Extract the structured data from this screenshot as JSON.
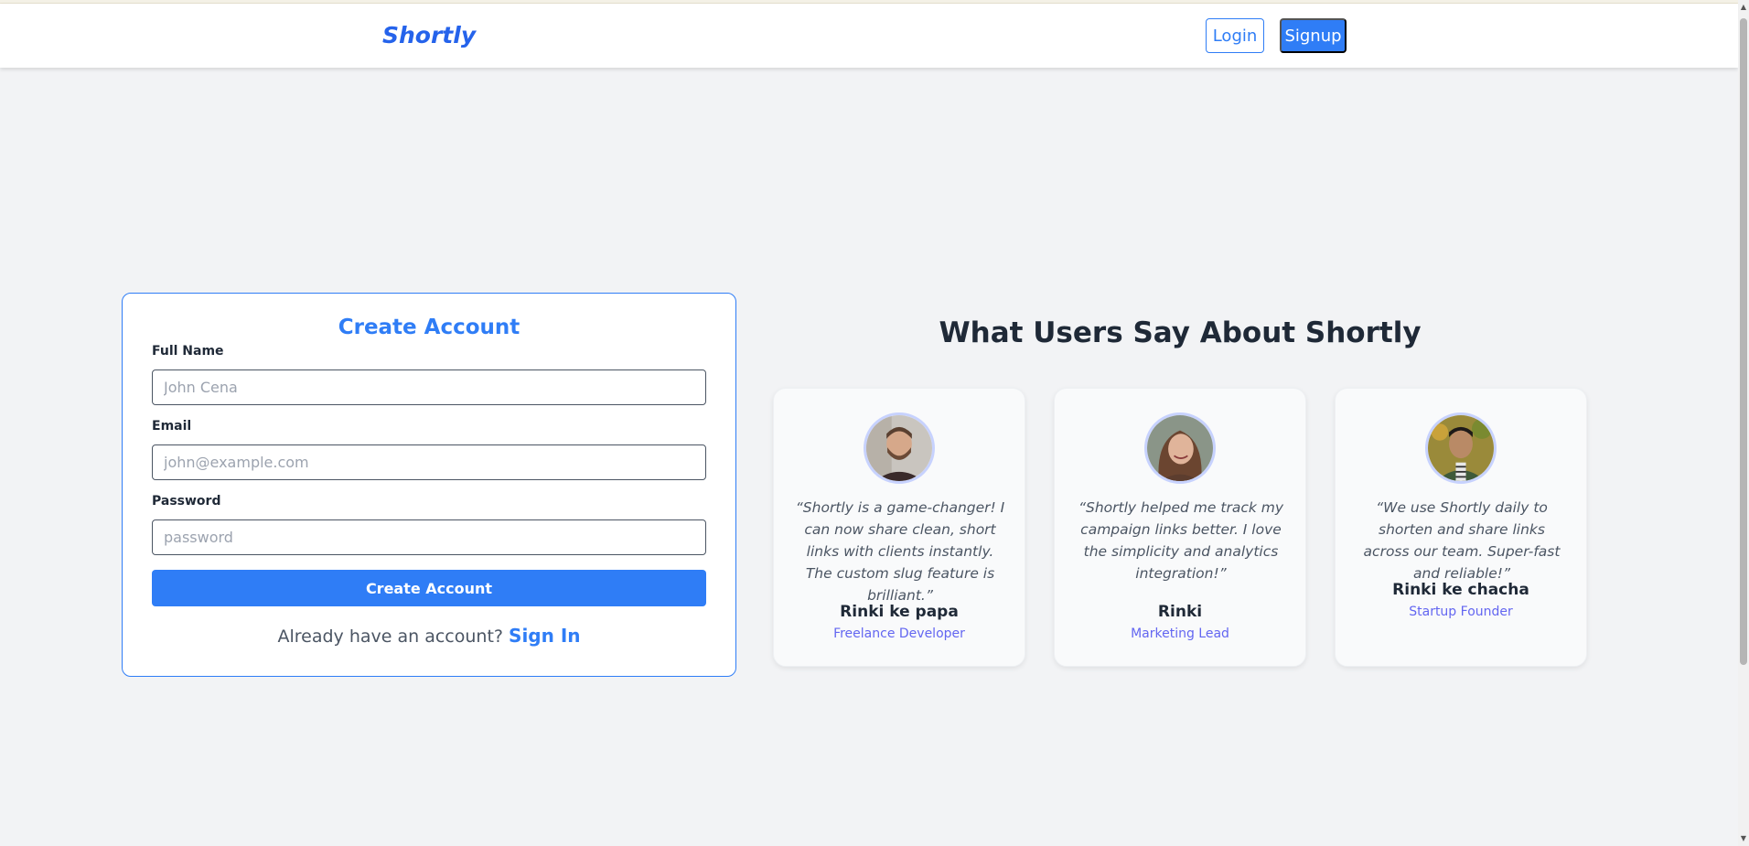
{
  "nav": {
    "brand": "Shortly",
    "login_label": "Login",
    "signup_label": "Signup"
  },
  "form": {
    "title": "Create Account",
    "fields": [
      {
        "label": "Full Name",
        "placeholder": "John Cena",
        "value": ""
      },
      {
        "label": "Email",
        "placeholder": "john@example.com",
        "value": ""
      },
      {
        "label": "Password",
        "placeholder": "password",
        "value": ""
      }
    ],
    "submit_label": "Create Account",
    "signin_prompt": "Already have an account?",
    "signin_link": "Sign In"
  },
  "testimonials": {
    "heading": "What Users Say About Shortly",
    "items": [
      {
        "quote": "“Shortly is a game-changer! I can now share clean, short links with clients instantly. The custom slug feature is brilliant.”",
        "name": "Rinki ke papa",
        "role": "Freelance Developer",
        "avatar": "man-beard-photo"
      },
      {
        "quote": "“Shortly helped me track my campaign links better. I love the simplicity and analytics integration!”",
        "name": "Rinki",
        "role": "Marketing Lead",
        "avatar": "woman-smiling-photo"
      },
      {
        "quote": "“We use Shortly daily to shorten and share links across our team. Super-fast and reliable!”",
        "name": "Rinki ke chacha",
        "role": "Startup Founder",
        "avatar": "man-outdoor-photo"
      }
    ]
  },
  "colors": {
    "primary": "#2f7df6",
    "brand": "#2563eb",
    "role": "#6366f1",
    "background": "#f2f3f5"
  }
}
